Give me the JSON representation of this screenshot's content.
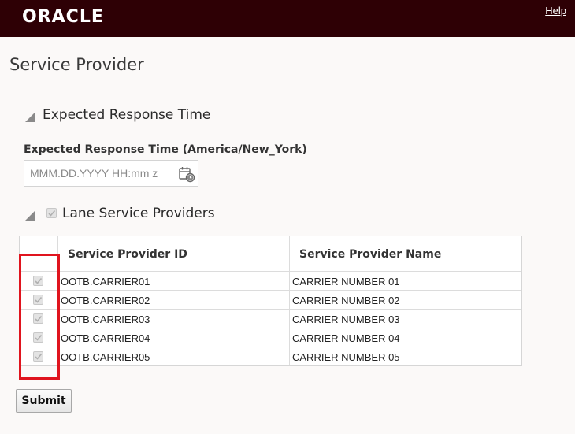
{
  "header": {
    "logo_text": "ORACLE",
    "help_label": "Help"
  },
  "page": {
    "title": "Service Provider"
  },
  "expected_response": {
    "section_title": "Expected Response Time",
    "field_label": "Expected Response Time (America/New_York)",
    "field_value": "",
    "field_placeholder": "MMM.DD.YYYY HH:mm z",
    "icon": "calendar-clock-icon"
  },
  "lane_providers": {
    "section_title": "Lane Service Providers",
    "section_checked": true,
    "columns": [
      "Service Provider ID",
      "Service Provider Name"
    ],
    "rows": [
      {
        "checked": true,
        "id": "OOTB.CARRIER01",
        "name": "CARRIER NUMBER 01"
      },
      {
        "checked": true,
        "id": "OOTB.CARRIER02",
        "name": "CARRIER NUMBER 02"
      },
      {
        "checked": true,
        "id": "OOTB.CARRIER03",
        "name": "CARRIER NUMBER 03"
      },
      {
        "checked": true,
        "id": "OOTB.CARRIER04",
        "name": "CARRIER NUMBER 04"
      },
      {
        "checked": true,
        "id": "OOTB.CARRIER05",
        "name": "CARRIER NUMBER 05"
      }
    ]
  },
  "actions": {
    "submit_label": "Submit"
  },
  "colors": {
    "header_bg": "#2e0005",
    "highlight": "#e0141e"
  }
}
